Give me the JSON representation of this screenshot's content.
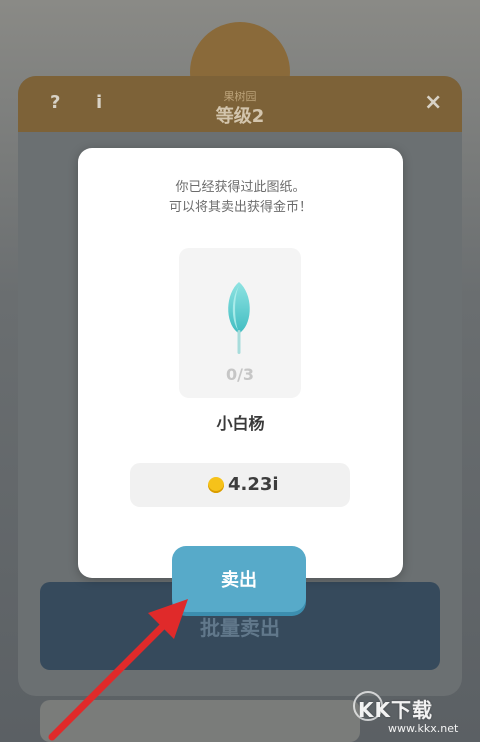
{
  "background": {
    "level_label": "等级2",
    "level_sublabel": "果树园",
    "help_icon_text": "?",
    "info_icon_text": "i",
    "close_icon_text": "×",
    "batch_sell_label": "批量卖出"
  },
  "dialog": {
    "message_line1": "你已经获得过此图纸。",
    "message_line2": "可以将其卖出获得金币！",
    "item": {
      "icon": "poplar-tree-icon",
      "progress": "0/3",
      "name": "小白杨"
    },
    "price": {
      "icon": "gold-coin-icon",
      "amount": "4.23i"
    }
  },
  "sell_button": {
    "label": "卖出"
  },
  "watermark": {
    "text": "KK下载",
    "url": "www.kkx.net"
  },
  "colors": {
    "accent_button": "#57aac9",
    "coin": "#f6c21a",
    "arrow": "#e02a2a"
  }
}
